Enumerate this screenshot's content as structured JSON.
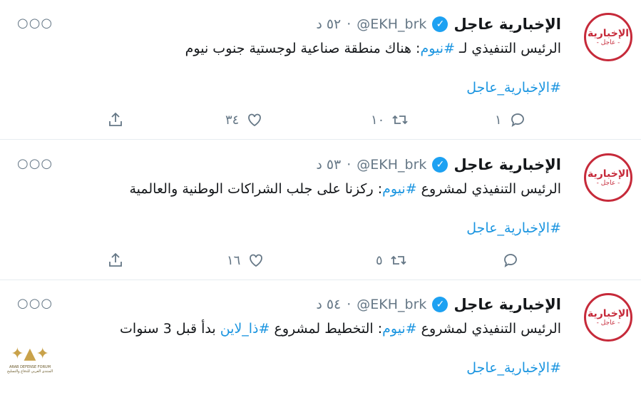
{
  "tweets": [
    {
      "name": "الإخبارية عاجل",
      "handle": "@EKH_brk",
      "time": "٥٢ د",
      "text_pre": "الرئيس التنفيذي لـ ",
      "text_tag": "#نيوم",
      "text_post": ": هناك منطقة صناعية لوجستية جنوب نيوم",
      "text_tag2": "",
      "text_post2": "",
      "hashtag": "#الإخبارية_عاجل",
      "replies": "١",
      "retweets": "١٠",
      "likes": "٣٤"
    },
    {
      "name": "الإخبارية عاجل",
      "handle": "@EKH_brk",
      "time": "٥٣ د",
      "text_pre": "الرئيس التنفيذي لمشروع ",
      "text_tag": "#نيوم",
      "text_post": ": ركزنا على جلب الشراكات الوطنية والعالمية",
      "text_tag2": "",
      "text_post2": "",
      "hashtag": "#الإخبارية_عاجل",
      "replies": "",
      "retweets": "٥",
      "likes": "١٦"
    },
    {
      "name": "الإخبارية عاجل",
      "handle": "@EKH_brk",
      "time": "٥٤ د",
      "text_pre": "الرئيس التنفيذي لمشروع ",
      "text_tag": "#نيوم",
      "text_post": ": التخطيط لمشروع ",
      "text_tag2": "#ذا_لاين",
      "text_post2": " بدأ قبل 3 سنوات",
      "hashtag": "#الإخبارية_عاجل",
      "replies": "",
      "retweets": "",
      "likes": ""
    }
  ],
  "avatar": {
    "main": "الإخبارية",
    "sub": "- عاجل -"
  },
  "separator": "·",
  "watermark": {
    "line1": "ARAB DEFENSE FORUM",
    "line2": "المنتدى العربي للدفاع والتسليح"
  },
  "colors": {
    "accent": "#1da1f2",
    "link": "#1b95e0",
    "muted": "#657786",
    "brand": "#c62a3a"
  }
}
